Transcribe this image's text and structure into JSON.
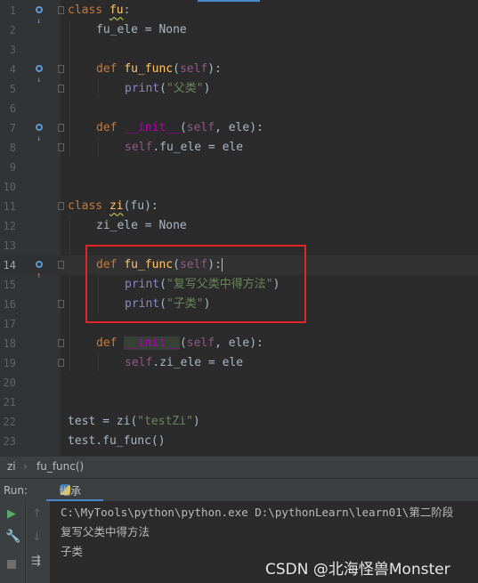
{
  "editor": {
    "line_numbers": [
      "1",
      "2",
      "3",
      "4",
      "5",
      "6",
      "7",
      "8",
      "9",
      "10",
      "11",
      "12",
      "13",
      "14",
      "15",
      "16",
      "17",
      "18",
      "19",
      "20",
      "21",
      "22",
      "23"
    ],
    "lines": {
      "l1": {
        "kw": "class",
        "name": "fu",
        "colon": ":"
      },
      "l2": {
        "text": "fu_ele = None"
      },
      "l4": {
        "kw": "def",
        "fn": "fu_func",
        "self": "self",
        "open": "(",
        "close": "):"
      },
      "l5": {
        "call": "print",
        "str": "\"父类\"",
        "open": "(",
        "close": ")"
      },
      "l7": {
        "kw": "def",
        "fn": "__init__",
        "open": "(",
        "self": "self",
        "rest": ", ele):"
      },
      "l8": {
        "self": "self",
        "rest": ".fu_ele = ele"
      },
      "l11": {
        "kw": "class",
        "name": "zi",
        "rest": "(fu):"
      },
      "l12": {
        "text": "zi_ele = None"
      },
      "l14": {
        "kw": "def",
        "fn": "fu_func",
        "self": "self",
        "open": "(",
        "close": "):"
      },
      "l15": {
        "call": "print",
        "str": "\"复写父类中得方法\"",
        "open": "(",
        "close": ")"
      },
      "l16": {
        "call": "print",
        "str": "\"子类\"",
        "open": "(",
        "close": ")"
      },
      "l18": {
        "kw": "def",
        "fn": "__init__",
        "open": "(",
        "self": "self",
        "rest": ", ele):"
      },
      "l19": {
        "self": "self",
        "rest": ".zi_ele = ele"
      },
      "l22": {
        "pre": "test = zi(",
        "str": "\"testZi\"",
        "post": ")"
      },
      "l23": {
        "text": "test.fu_func()"
      }
    }
  },
  "breadcrumb": {
    "class": "zi",
    "sep": "›",
    "method": "fu_func()"
  },
  "run": {
    "label": "Run:",
    "tab": "继承",
    "output": [
      "C:\\MyTools\\python\\python.exe D:\\pythonLearn\\learn01\\第二阶段",
      "复写父类中得方法",
      "子类"
    ]
  },
  "watermark": "CSDN @北海怪兽Monster",
  "colors": {
    "keyword": "#cc7832",
    "function": "#ffc66d",
    "self": "#94558d",
    "string": "#6a8759",
    "builtin": "#8888c6",
    "highlight_box": "#e0262b"
  }
}
